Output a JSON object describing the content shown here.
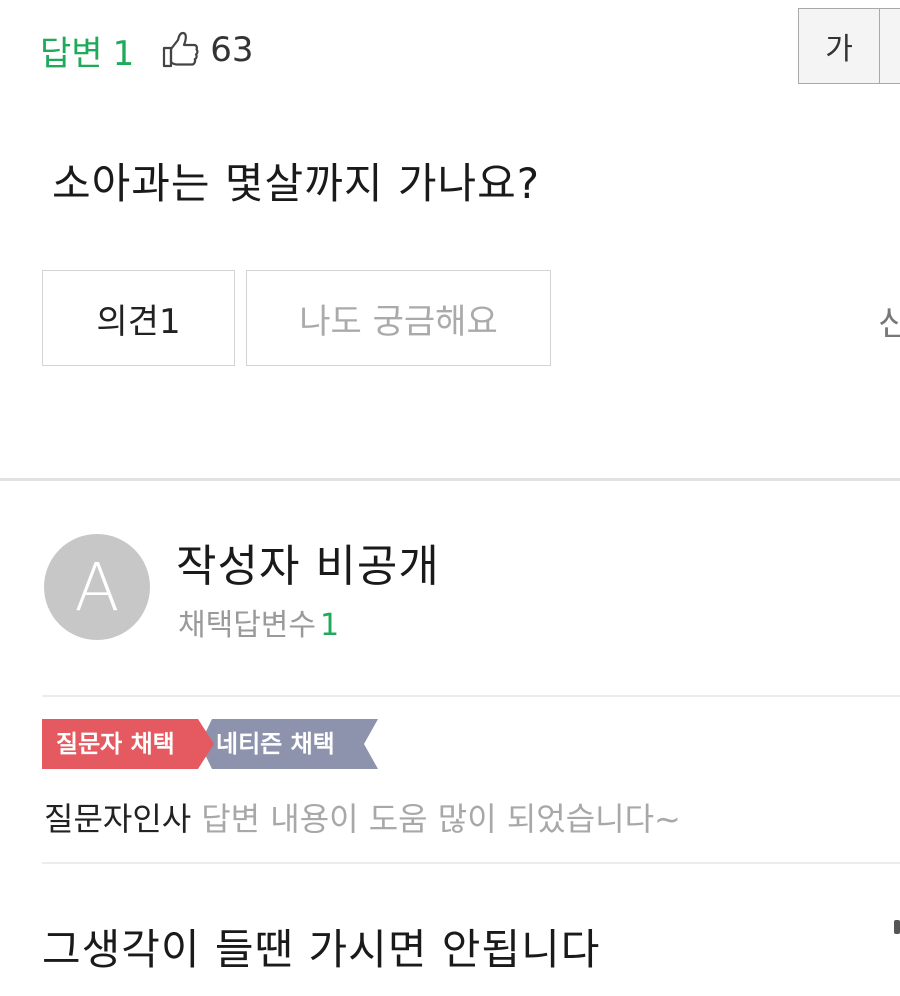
{
  "question": {
    "answer_label": "답변",
    "answer_count": "1",
    "like_icon": "thumbs-up-icon",
    "like_count": "63",
    "font_size_label": "가",
    "title": "소아과는 몇살까지 가나요?",
    "opinion_label": "의견1",
    "curious_label": "나도 궁금해요",
    "edge_glyph": "신"
  },
  "answer": {
    "avatar_letter": "A",
    "author": "작성자 비공개",
    "adopted_label": "채택답변수",
    "adopted_count": "1",
    "badges": {
      "questioner": "질문자 채택",
      "netizen": "네티즌 채택"
    },
    "thanks_label": "질문자인사",
    "thanks_message": "답변 내용이 도움 많이 되었습니다~",
    "body": "그생각이 들땐 가시면 안됩니다"
  },
  "colors": {
    "accent_green": "#1eaa5a",
    "badge_red": "#e45a60",
    "badge_blue_gray": "#8d93ad"
  }
}
